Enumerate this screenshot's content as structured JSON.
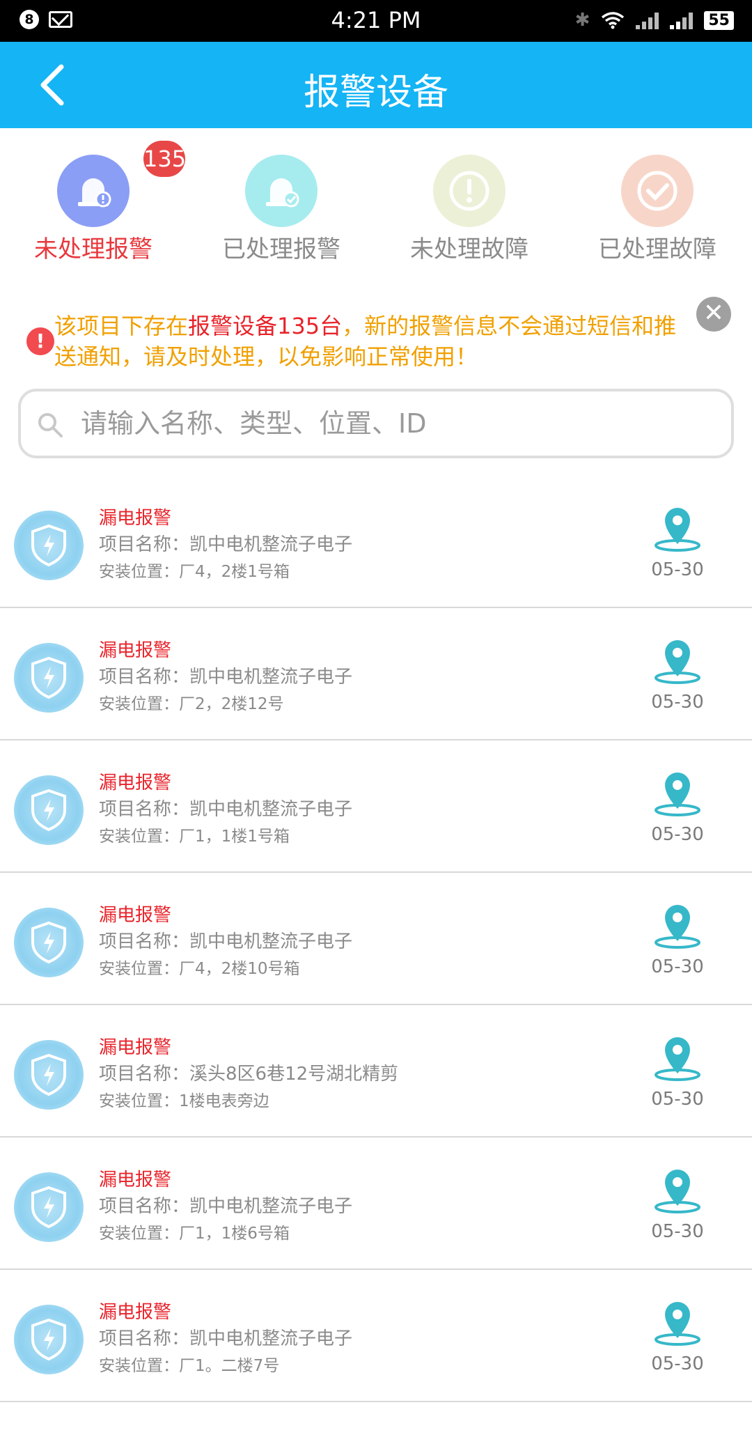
{
  "status_bar": {
    "notification_count": "8",
    "time": "4:21 PM",
    "battery": "55"
  },
  "header": {
    "title": "报警设备"
  },
  "tabs": [
    {
      "label": "未处理报警",
      "icon": "unhandled-alarm-icon",
      "color": "#8b9ef5",
      "active": true
    },
    {
      "label": "已处理报警",
      "icon": "handled-alarm-icon",
      "color": "#a6ecef",
      "active": false
    },
    {
      "label": "未处理故障",
      "icon": "unhandled-fault-icon",
      "color": "#ecf0d6",
      "active": false
    },
    {
      "label": "已处理故障",
      "icon": "handled-fault-icon",
      "color": "#f7d6c9",
      "active": false
    }
  ],
  "alarm_count_badge": "135",
  "notice": {
    "text_before": "该项目下存在",
    "text_highlight": "报警设备135台",
    "text_after": "，新的报警信息不会通过短信和推送通知，请及时处理，以免影响正常使用！"
  },
  "search": {
    "placeholder": "请输入名称、类型、位置、ID"
  },
  "devices": [
    {
      "type": "漏电报警",
      "project": "项目名称：凯中电机整流子电子",
      "location": "安装位置：厂4，2楼1号箱",
      "date": "05-30"
    },
    {
      "type": "漏电报警",
      "project": "项目名称：凯中电机整流子电子",
      "location": "安装位置：厂2，2楼12号",
      "date": "05-30"
    },
    {
      "type": "漏电报警",
      "project": "项目名称：凯中电机整流子电子",
      "location": "安装位置：厂1，1楼1号箱",
      "date": "05-30"
    },
    {
      "type": "漏电报警",
      "project": "项目名称：凯中电机整流子电子",
      "location": "安装位置：厂4，2楼10号箱",
      "date": "05-30"
    },
    {
      "type": "漏电报警",
      "project": "项目名称：溪头8区6巷12号湖北精剪",
      "location": "安装位置：1楼电表旁边",
      "date": "05-30"
    },
    {
      "type": "漏电报警",
      "project": "项目名称：凯中电机整流子电子",
      "location": "安装位置：厂1，1楼6号箱",
      "date": "05-30"
    },
    {
      "type": "漏电报警",
      "project": "项目名称：凯中电机整流子电子",
      "location": "安装位置：厂1。二楼7号",
      "date": "05-30"
    }
  ],
  "colors": {
    "primary": "#14b4f5",
    "alarm_red": "#e8232a",
    "notice_orange": "#f0a000",
    "pin_teal": "#36b8c9"
  }
}
